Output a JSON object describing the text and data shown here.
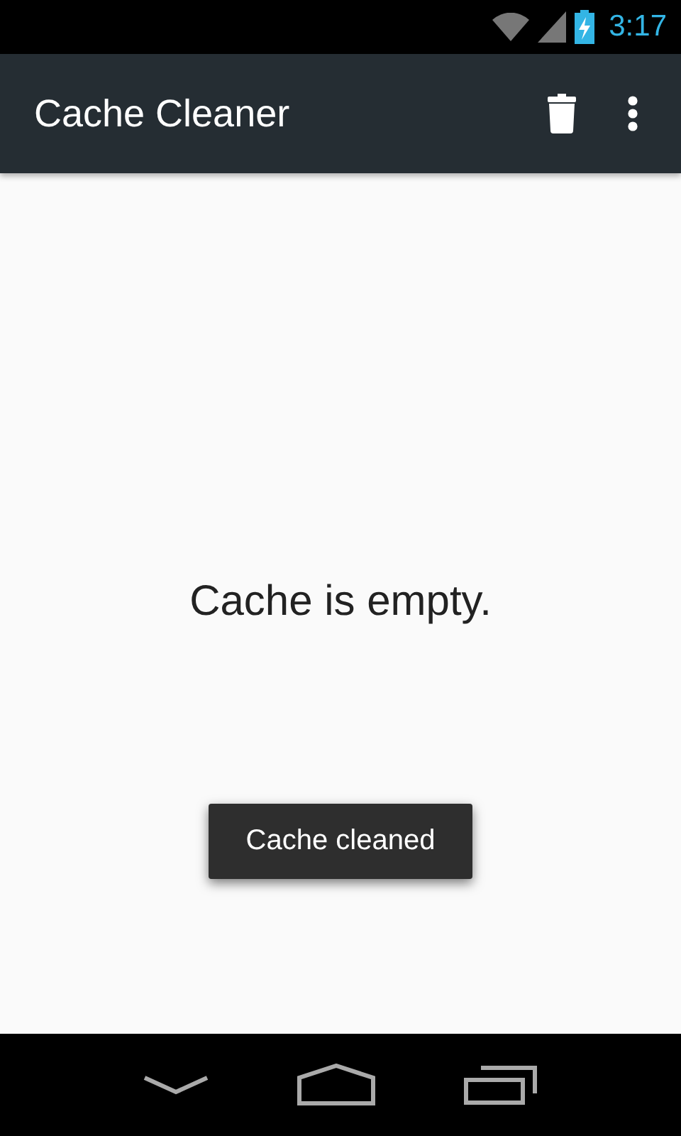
{
  "status_bar": {
    "time": "3:17"
  },
  "action_bar": {
    "title": "Cache Cleaner"
  },
  "content": {
    "message": "Cache is empty."
  },
  "toast": {
    "text": "Cache cleaned"
  }
}
